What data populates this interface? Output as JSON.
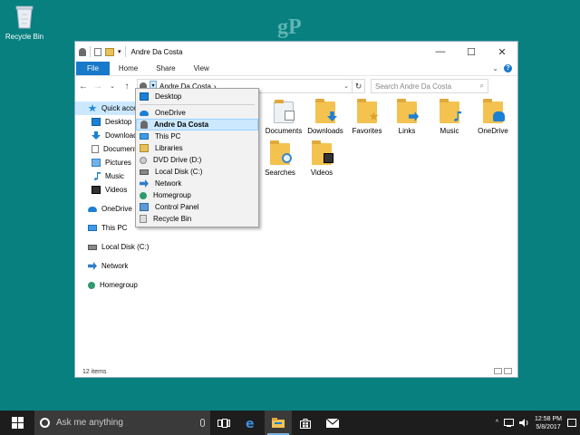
{
  "desktop": {
    "recycle_bin_label": "Recycle Bin",
    "watermark": "gP"
  },
  "window": {
    "title": "Andre Da Costa",
    "controls": {
      "minimize": "—",
      "maximize": "☐",
      "close": "✕"
    },
    "ribbon_tabs": [
      "File",
      "Home",
      "Share",
      "View"
    ],
    "ribbon_right": {
      "expand": "⌄",
      "help": "?"
    },
    "nav": {
      "back": "←",
      "forward": "→",
      "recent": "⌄",
      "up": "↑"
    },
    "address": {
      "path": "Andre Da Costa",
      "chevron": "›",
      "dropdown_arrow": "⌄",
      "refresh": "↻"
    },
    "search": {
      "placeholder": "Search Andre Da Costa",
      "icon": "⌕"
    },
    "status": "12 items"
  },
  "sidebar": {
    "items": [
      {
        "label": "Quick access",
        "icon": "star-icon"
      },
      {
        "label": "Desktop",
        "icon": "desktop-icon"
      },
      {
        "label": "Downloads",
        "icon": "downloads-icon"
      },
      {
        "label": "Documents",
        "icon": "documents-icon"
      },
      {
        "label": "Pictures",
        "icon": "pictures-icon"
      },
      {
        "label": "Music",
        "icon": "music-icon"
      },
      {
        "label": "Videos",
        "icon": "videos-icon"
      },
      {
        "label": "OneDrive",
        "icon": "onedrive-icon"
      },
      {
        "label": "This PC",
        "icon": "this-pc-icon"
      },
      {
        "label": "Local Disk (C:)",
        "icon": "local-disk-icon"
      },
      {
        "label": "Network",
        "icon": "network-icon"
      },
      {
        "label": "Homegroup",
        "icon": "homegroup-icon"
      }
    ]
  },
  "content": {
    "tiles": [
      {
        "label": "Documents",
        "badge": "document-icon"
      },
      {
        "label": "Downloads",
        "badge": "downloads-icon"
      },
      {
        "label": "Favorites",
        "badge": "star-icon"
      },
      {
        "label": "Links",
        "badge": "link-arrow-icon"
      },
      {
        "label": "Music",
        "badge": "music-note-icon"
      },
      {
        "label": "OneDrive",
        "badge": "onedrive-icon"
      },
      {
        "label": "Searches",
        "badge": "magnifier-icon"
      },
      {
        "label": "Videos",
        "badge": "film-icon"
      }
    ]
  },
  "dropdown": {
    "items": [
      {
        "label": "Desktop",
        "icon": "desktop-icon"
      },
      {
        "label": "OneDrive",
        "icon": "onedrive-icon"
      },
      {
        "label": "Andre Da Costa",
        "icon": "user-icon",
        "selected": true
      },
      {
        "label": "This PC",
        "icon": "this-pc-icon"
      },
      {
        "label": "Libraries",
        "icon": "libraries-icon"
      },
      {
        "label": "DVD Drive (D:)",
        "icon": "dvd-drive-icon"
      },
      {
        "label": "Local Disk (C:)",
        "icon": "local-disk-icon"
      },
      {
        "label": "Network",
        "icon": "network-icon"
      },
      {
        "label": "Homegroup",
        "icon": "homegroup-icon"
      },
      {
        "label": "Control Panel",
        "icon": "control-panel-icon"
      },
      {
        "label": "Recycle Bin",
        "icon": "recycle-bin-icon"
      }
    ]
  },
  "taskbar": {
    "search_placeholder": "Ask me anything",
    "time": "12:58 PM",
    "date": "5/8/2017",
    "tray_chevron": "^"
  },
  "colors": {
    "desktop_bg": "#07807f",
    "accent": "#1979ca",
    "selection": "#cce8ff",
    "folder": "#f3c24f",
    "taskbar": "#1d1d1d"
  }
}
